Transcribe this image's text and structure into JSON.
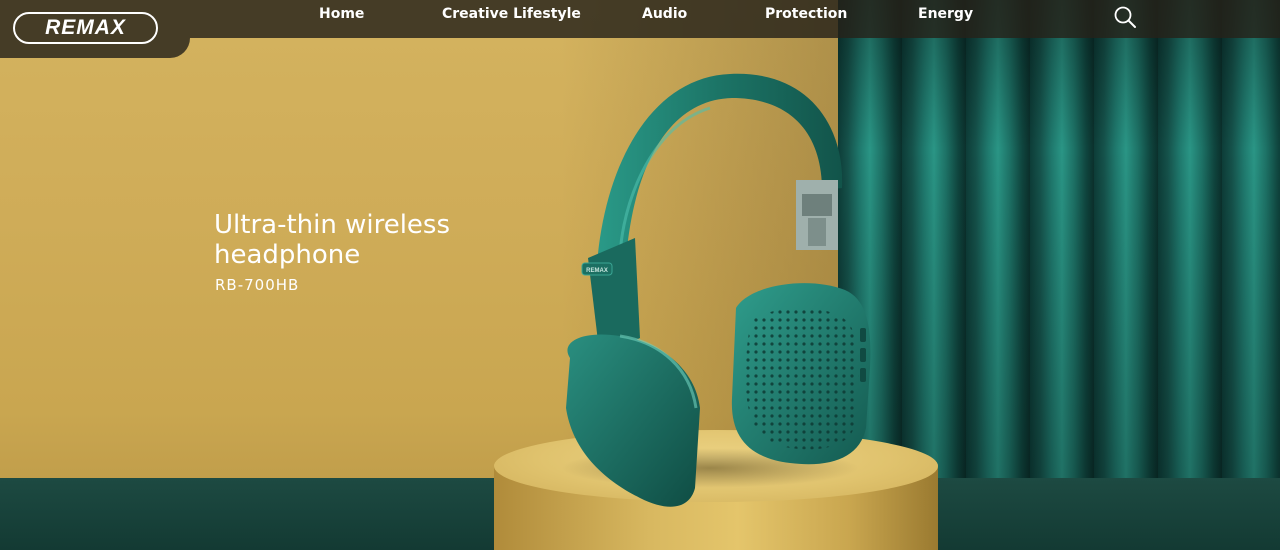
{
  "brand": {
    "logo_text": "REMAX"
  },
  "nav": {
    "items": [
      {
        "label": "Home"
      },
      {
        "label": "Creative Lifestyle"
      },
      {
        "label": "Audio"
      },
      {
        "label": "Protection"
      },
      {
        "label": "Energy"
      }
    ],
    "search_icon": "search-icon"
  },
  "hero": {
    "headline_line1": "Ultra-thin wireless",
    "headline_line2": "headphone",
    "model": "RB-700HB",
    "product_badge": "REMAX"
  },
  "colors": {
    "wall": "#cfac58",
    "curtain": "#1f7a6e",
    "headphone": "#1e7a6c",
    "nav_bg": "#26221a"
  }
}
